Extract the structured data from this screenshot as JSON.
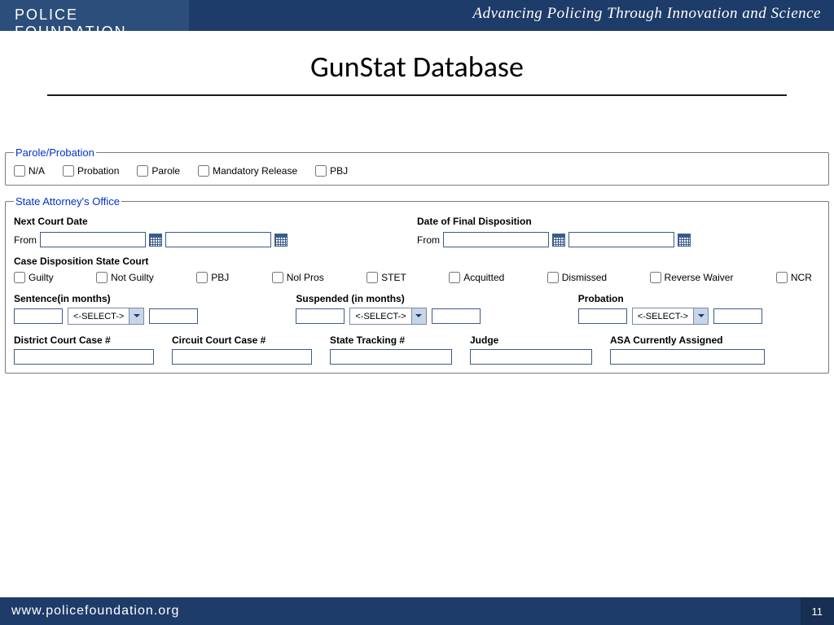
{
  "header": {
    "org": "POLICE FOUNDATION",
    "tagline": "Advancing Policing Through  Innovation and Science"
  },
  "title": "GunStat Database",
  "parole": {
    "legend": "Parole/Probation",
    "options": [
      "N/A",
      "Probation",
      "Parole",
      "Mandatory Release",
      "PBJ"
    ]
  },
  "sao": {
    "legend": "State Attorney's Office",
    "nextCourt": "Next Court Date",
    "finalDisp": "Date of Final Disposition",
    "from": "From",
    "caseDisp": "Case Disposition State Court",
    "dispositions": [
      "Guilty",
      "Not Guilty",
      "PBJ",
      "Nol Pros",
      "STET",
      "Acquitted",
      "Dismissed",
      "Reverse Waiver",
      "NCR"
    ],
    "sentence": "Sentence(in months)",
    "suspended": "Suspended (in months)",
    "probation": "Probation",
    "selectPlaceholder": "<-SELECT->",
    "districtCase": "District Court Case #",
    "circuitCase": "Circuit Court Case #",
    "stateTracking": "State Tracking #",
    "judge": "Judge",
    "asa": "ASA Currently Assigned"
  },
  "footer": {
    "url": "www.policefoundation.org",
    "page": "11"
  }
}
